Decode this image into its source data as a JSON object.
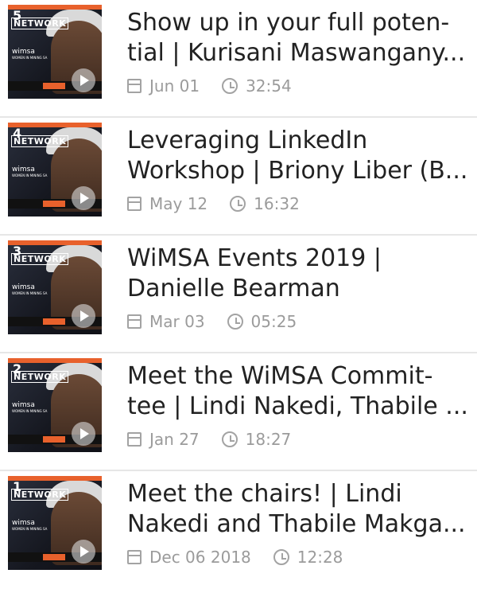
{
  "items": [
    {
      "episode": "5",
      "thumb_brand": "NETWORK",
      "thumb_logo": "wimsa",
      "thumb_sub": "WOMEN IN MINING SA",
      "title": "Show up in your full poten-tial | Kurisani Maswangany...",
      "date": "Jun 01",
      "duration": "32:54"
    },
    {
      "episode": "4",
      "thumb_brand": "NETWORK",
      "thumb_logo": "wimsa",
      "thumb_sub": "WOMEN IN MINING SA",
      "title": "Leveraging LinkedIn Workshop | Briony Liber (B...",
      "date": "May 12",
      "duration": "16:32"
    },
    {
      "episode": "3",
      "thumb_brand": "NETWORK",
      "thumb_logo": "wimsa",
      "thumb_sub": "WOMEN IN MINING SA",
      "title": "WiMSA Events 2019 | Danielle Bearman",
      "date": "Mar 03",
      "duration": "05:25"
    },
    {
      "episode": "2",
      "thumb_brand": "NETWORK",
      "thumb_logo": "wimsa",
      "thumb_sub": "WOMEN IN MINING SA",
      "title": "Meet the WiMSA Commit-tee | Lindi Nakedi, Thabile ...",
      "date": "Jan 27",
      "duration": "18:27"
    },
    {
      "episode": "1",
      "thumb_brand": "NETWORK",
      "thumb_logo": "wimsa",
      "thumb_sub": "WOMEN IN MINING SA",
      "title": "Meet the chairs! | Lindi Nakedi and Thabile Makga...",
      "date": "Dec 06 2018",
      "duration": "12:28"
    }
  ]
}
